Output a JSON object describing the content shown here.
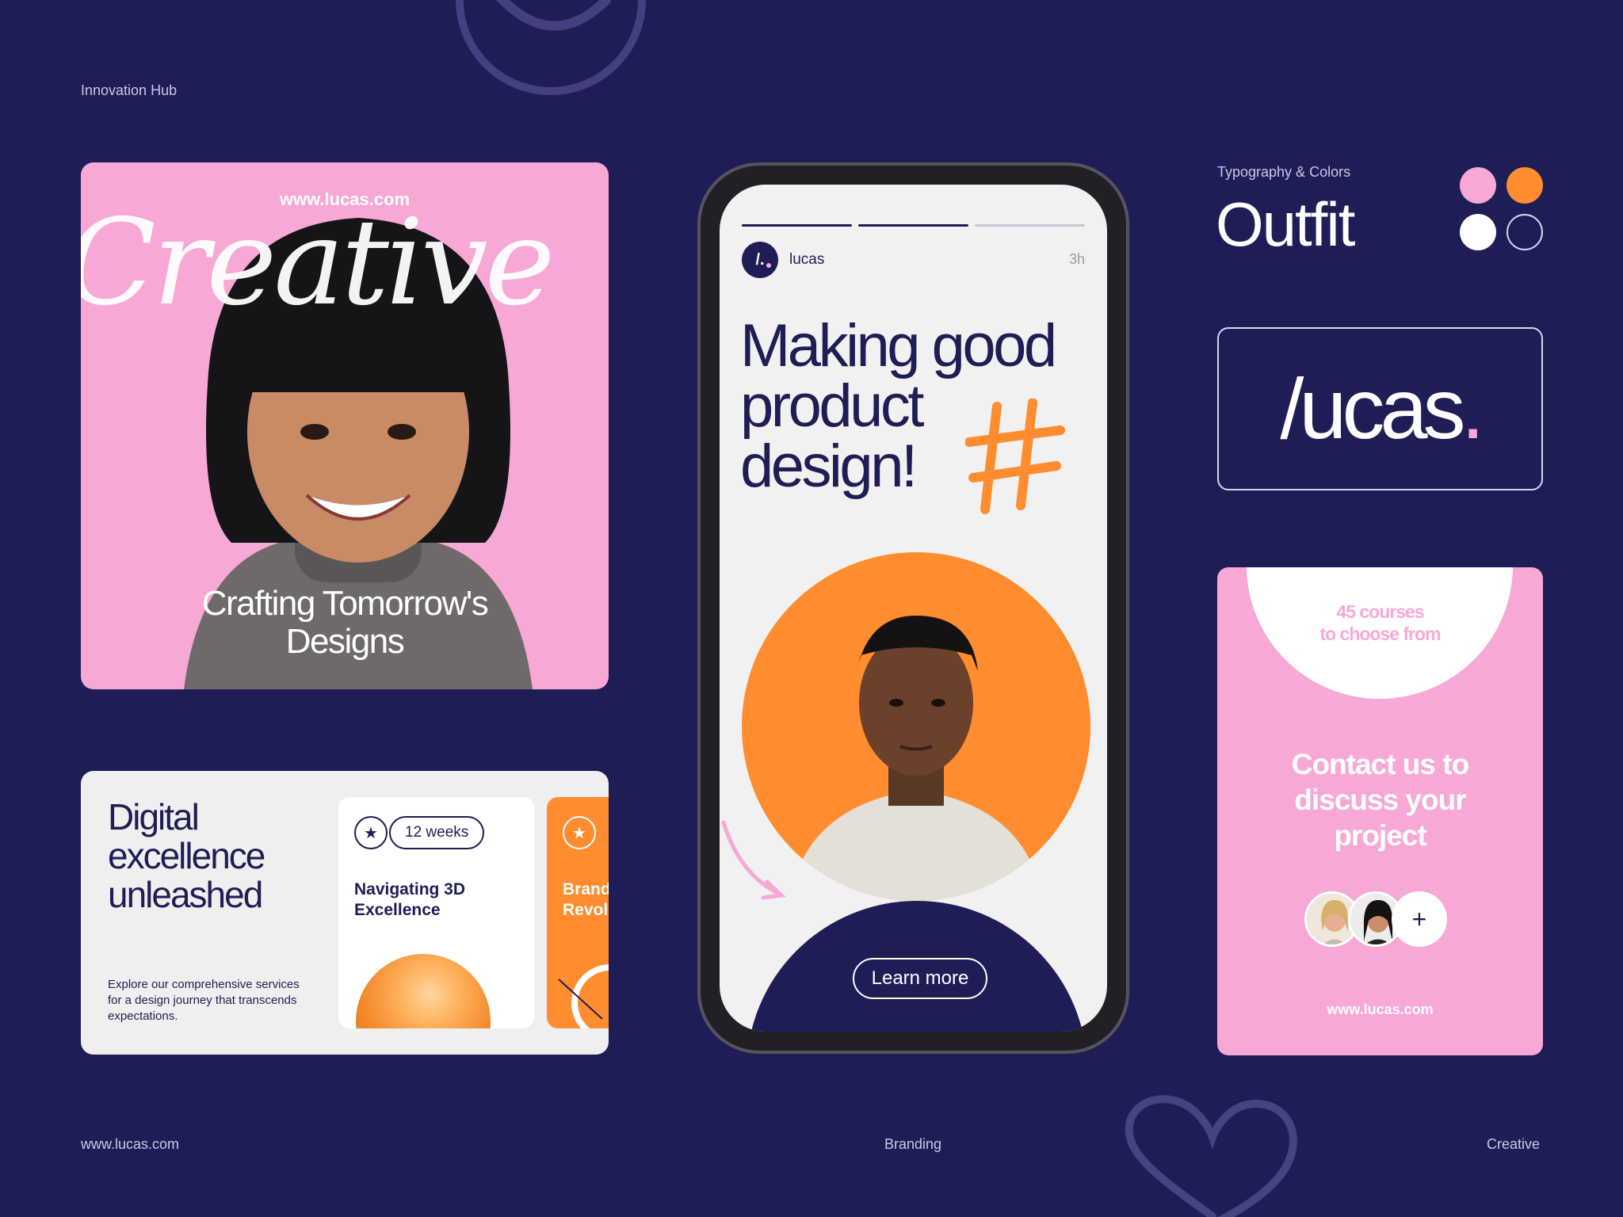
{
  "header": {
    "brand_label": "Innovation Hub"
  },
  "footer": {
    "left": "www.lucas.com",
    "center": "Branding",
    "right": "Creative"
  },
  "creative_card": {
    "url": "www.lucas.com",
    "script_word": "Creative",
    "tagline_line1": "Crafting Tomorrow's",
    "tagline_line2": "Designs"
  },
  "digital_card": {
    "headline_line1": "Digital",
    "headline_line2": "excellence",
    "headline_line3": "unleashed",
    "blurb": "Explore our comprehensive services for a design journey that transcends expectations.",
    "course_card": {
      "star": "★",
      "badge": "12 weeks",
      "title_line1": "Navigating 3D",
      "title_line2": "Excellence"
    },
    "orange_card": {
      "star": "★",
      "title_line1": "Brand",
      "title_line2": "Revol"
    }
  },
  "phone": {
    "profile_initial": "/.",
    "profile_name": "lucas",
    "time_ago": "3h",
    "headline_line1": "Making good",
    "headline_line2": "product",
    "headline_line3": "design!",
    "button_label": "Learn more"
  },
  "typography": {
    "label": "Typography & Colors",
    "font_name": "Outfit",
    "colors": [
      "#f7a8d4",
      "#ff8c2e",
      "#ffffff",
      "#1f1d55"
    ]
  },
  "logo": {
    "word": "/ucas",
    "dot": "."
  },
  "contact_card": {
    "courses_line1": "45 courses",
    "courses_line2": "to choose from",
    "cta_line1": "Contact us to",
    "cta_line2": "discuss your",
    "cta_line3": "project",
    "plus": "+",
    "url": "www.lucas.com"
  }
}
